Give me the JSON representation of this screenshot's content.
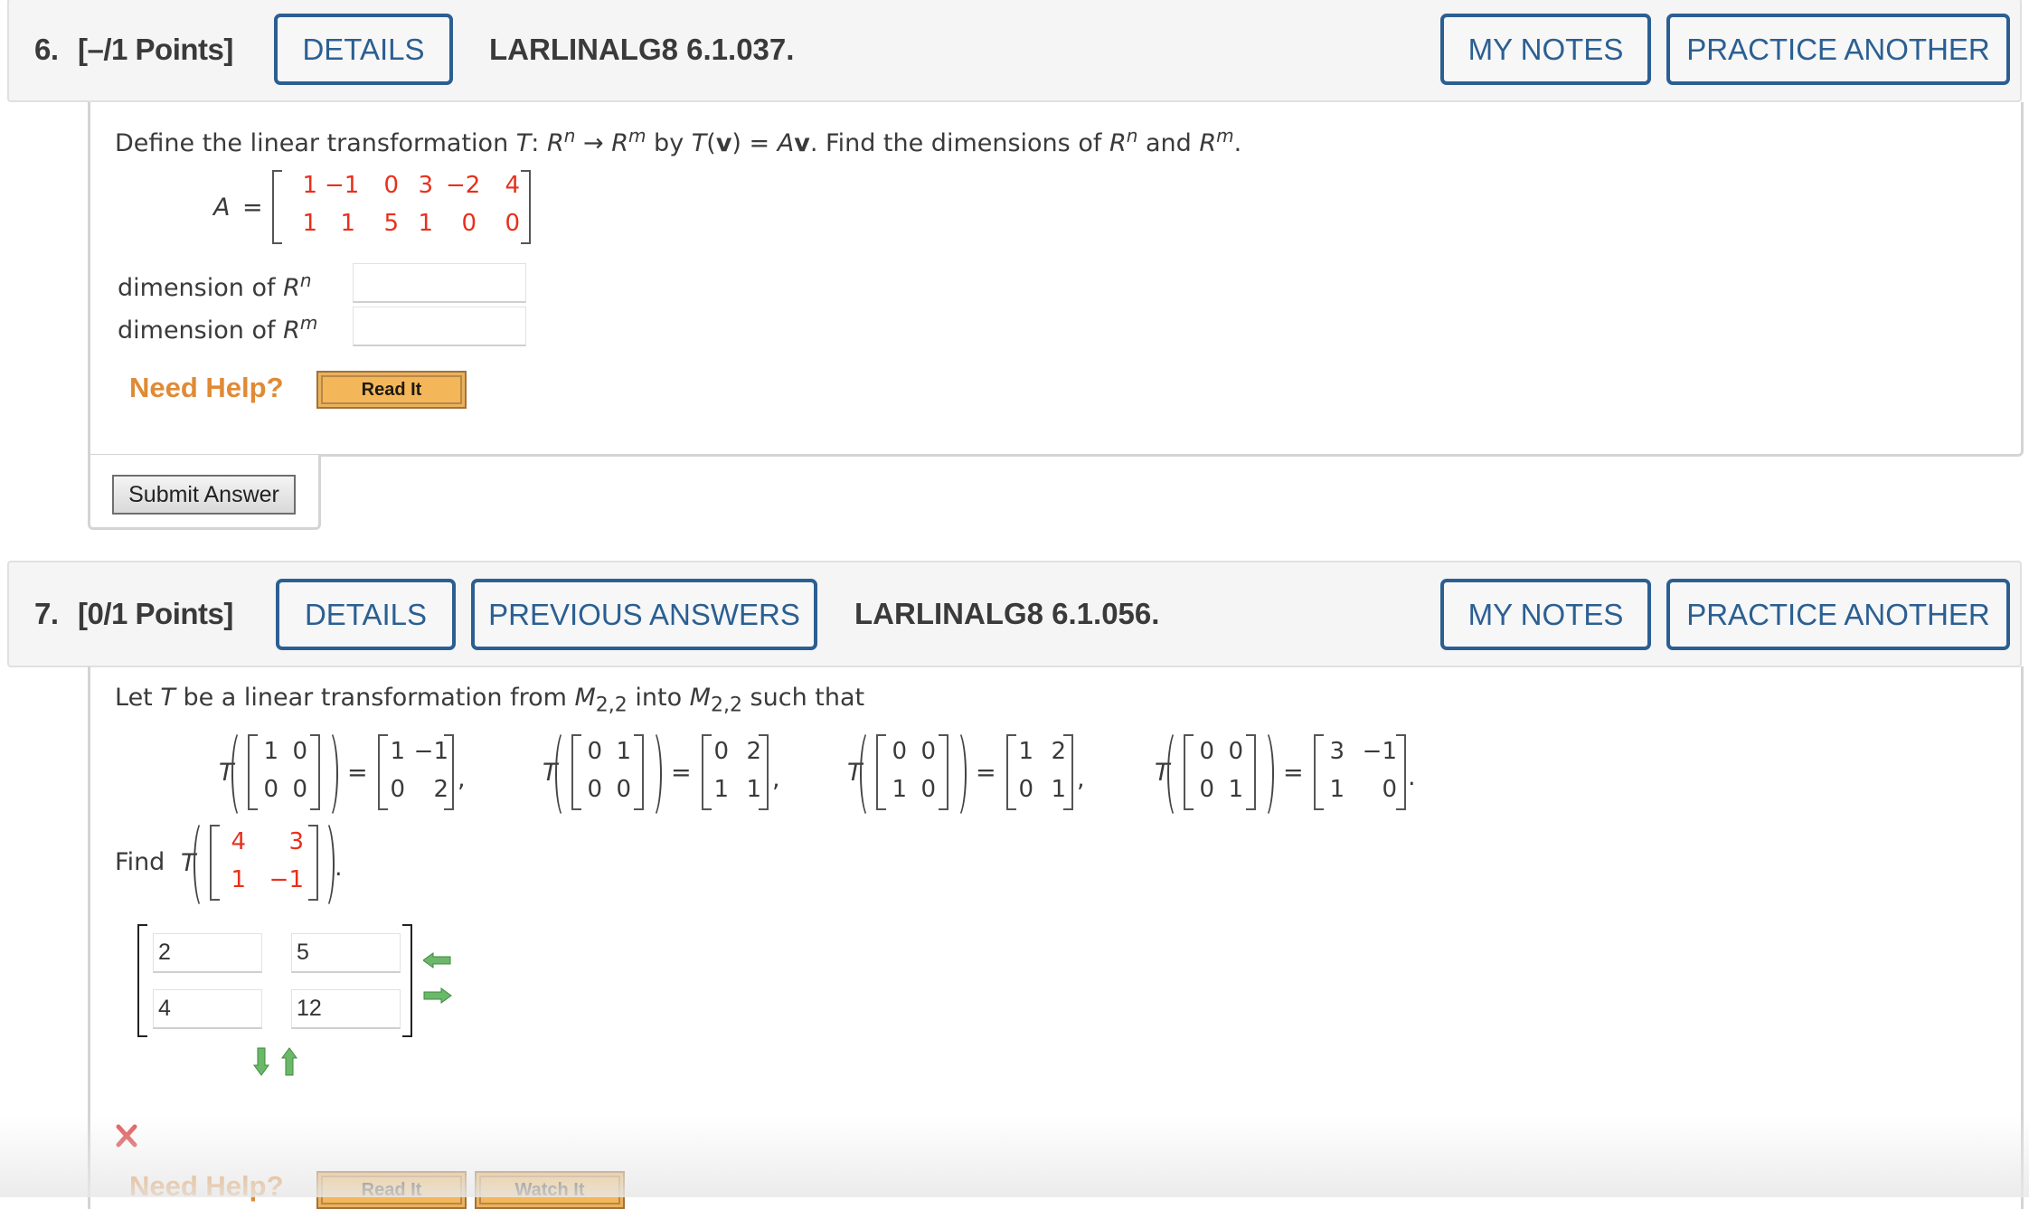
{
  "q6": {
    "number": "6.",
    "points": "[–/1 Points]",
    "details_label": "DETAILS",
    "code": "LARLINALG8 6.1.037.",
    "my_notes_label": "MY NOTES",
    "practice_label": "PRACTICE ANOTHER",
    "prompt": {
      "p1": "Define the linear transformation ",
      "T": "T",
      "colon": ": ",
      "R1": "R",
      "n": "n",
      "arrow": " → ",
      "R2": "R",
      "m": "m",
      "by": " by ",
      "Tv_T": "T",
      "Tv_open": "(",
      "Tv_v": "v",
      "Tv_close": ") = ",
      "Av_A": "A",
      "Av_v": "v",
      "find": ".  Find the dimensions of ",
      "R3": "R",
      "n2": "n",
      "and": " and ",
      "R4": "R",
      "m2": "m",
      "period": "."
    },
    "matrix_label": "A",
    "matrix_eq": "=",
    "matrix_A": [
      [
        "1",
        "−1",
        "0",
        "3",
        "−2",
        "4"
      ],
      [
        "1",
        "1",
        "5",
        "1",
        "0",
        "0"
      ]
    ],
    "dim_n_label": "dimension of ",
    "dim_n_R": "R",
    "dim_n_sup": "n",
    "dim_n_value": "",
    "dim_m_label": "dimension of ",
    "dim_m_R": "R",
    "dim_m_sup": "m",
    "dim_m_value": "",
    "need_help": "Need Help?",
    "read_it": "Read It",
    "submit": "Submit Answer"
  },
  "q7": {
    "number": "7.",
    "points": "[0/1 Points]",
    "details_label": "DETAILS",
    "previous_label": "PREVIOUS ANSWERS",
    "code": "LARLINALG8 6.1.056.",
    "my_notes_label": "MY NOTES",
    "practice_label": "PRACTICE ANOTHER",
    "prompt": {
      "p1": "Let ",
      "T": "T",
      "p2": " be a linear transformation from ",
      "M1": "M",
      "sub1": "2,2",
      "p3": " into ",
      "M2": "M",
      "sub2": "2,2",
      "p4": " such that"
    },
    "T_label": "T",
    "equals": "=",
    "comma": ",",
    "period": ".",
    "equations": [
      {
        "input": [
          [
            "1",
            "0"
          ],
          [
            "0",
            "0"
          ]
        ],
        "output": [
          [
            "1",
            "−1"
          ],
          [
            "0",
            "2"
          ]
        ]
      },
      {
        "input": [
          [
            "0",
            "1"
          ],
          [
            "0",
            "0"
          ]
        ],
        "output": [
          [
            "0",
            "2"
          ],
          [
            "1",
            "1"
          ]
        ]
      },
      {
        "input": [
          [
            "0",
            "0"
          ],
          [
            "1",
            "0"
          ]
        ],
        "output": [
          [
            "1",
            "2"
          ],
          [
            "0",
            "1"
          ]
        ]
      },
      {
        "input": [
          [
            "0",
            "0"
          ],
          [
            "0",
            "1"
          ]
        ],
        "output": [
          [
            "3",
            "−1"
          ],
          [
            "1",
            "0"
          ]
        ]
      }
    ],
    "find_label": "Find",
    "find_matrix": [
      [
        "4",
        "3"
      ],
      [
        "1",
        "−1"
      ]
    ],
    "answer": [
      [
        "2",
        "5"
      ],
      [
        "4",
        "12"
      ]
    ],
    "status": "incorrect",
    "need_help": "Need Help?",
    "read_it": "Read It",
    "watch_it": "Watch It"
  },
  "colors": {
    "accent_blue": "#2b5f92",
    "given_red": "#e8301c",
    "help_orange": "#e08a35",
    "arrow_green": "#4ea64a",
    "wrong_red": "#e05a5a"
  }
}
